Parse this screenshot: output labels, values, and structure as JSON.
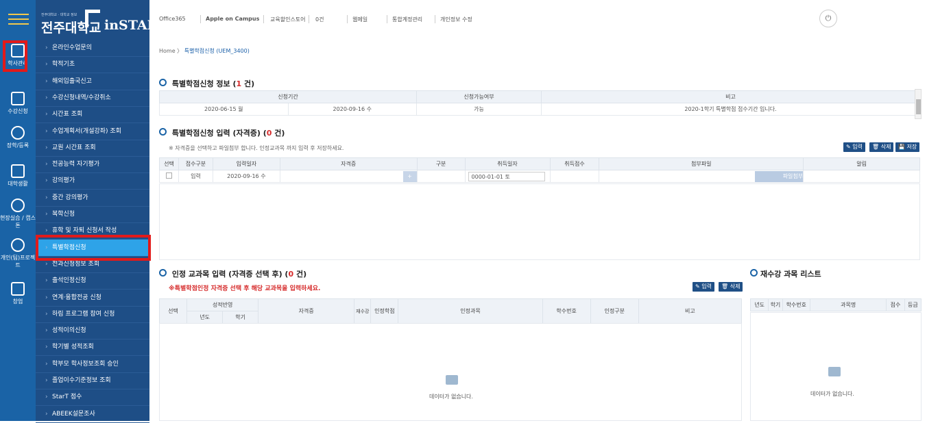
{
  "logo": {
    "tiny": "전주대학교 · 대학교 정보",
    "school": "전주대학교",
    "brand": "inSTAR"
  },
  "rail": [
    {
      "label": "학사관리"
    },
    {
      "label": "수강신청"
    },
    {
      "label": "장학/등록"
    },
    {
      "label": "대학생활"
    },
    {
      "label": "현장실습 / 캡스톤"
    },
    {
      "label": "개인(팀)프로젝트"
    },
    {
      "label": "창업"
    }
  ],
  "nav": [
    "온라인수업문의",
    "학적기초",
    "해외입출국신고",
    "수강신청내역/수강취소",
    "시간표 조회",
    "수업계획서(개설강좌) 조회",
    "교원 시간표 조회",
    "전공능력 자기평가",
    "강의평가",
    "중간 강의평가",
    "복학신청",
    "휴학 및 자퇴 신청서 작성",
    "특별학점신청",
    "전과신청정보 조회",
    "출석인정신청",
    "연계·융합전공 신청",
    "하림 프로그램 참여 신청",
    "성적이의신청",
    "학기별 성적조회",
    "학부모 학사정보조회 승인",
    "졸업이수기준정보 조회",
    "StarT 점수",
    "ABEEK설문조사"
  ],
  "topbar": [
    "Office365",
    "Apple on Campus",
    "교육할인스토어",
    "0건",
    "웹메일",
    "통합계정관리",
    "개인정보 수정"
  ],
  "power_icon": "power-icon",
  "breadcrumb": {
    "home": "Home",
    "sep": "〉",
    "page": "특별학점신청 (UEM_3400)"
  },
  "info": {
    "title": "특별학점신청 정보 (",
    "count": "1",
    "suffix": " 건)",
    "headers": [
      "신청기간",
      "신청가능여부",
      "비고"
    ],
    "row": [
      "2020-06-15 월",
      "2020-09-16 수",
      "가능",
      "2020-1학기 특별학점 접수기간 입니다."
    ]
  },
  "input": {
    "title": "특별학점신청 입력 (자격증) (",
    "count": "0",
    "suffix": " 건)",
    "note": "※ 자격증을 선택하고 파일첨부 합니다. 인정교과목 까지 입력 후 저장하세요.",
    "buttons": [
      "입력",
      "삭제",
      "저장"
    ],
    "headers": [
      "선택",
      "접수구분",
      "입력일자",
      "자격증",
      "구분",
      "취득일자",
      "취득점수",
      "첨부파일",
      "알림"
    ],
    "row": {
      "type": "입력",
      "date": "2020-09-16 수",
      "plus": "+",
      "acq_date": "0000-01-01 토",
      "attach": "파일첨부"
    }
  },
  "course": {
    "title": "인정 교과목 입력 (자격증 선택 후) (",
    "count": "0",
    "suffix": " 건)",
    "note": "※특별학점인정 자격증 선택 후 해당 교과목을 입력하세요.",
    "buttons": [
      "입력",
      "삭제"
    ],
    "headers": [
      "선택",
      "성적반영",
      "년도",
      "학기",
      "자격증",
      "재수강",
      "인정학점",
      "인정과목",
      "학수번호",
      "인정구분",
      "비고"
    ],
    "empty": "데이터가 없습니다."
  },
  "retake": {
    "title": "재수강 과목 리스트",
    "headers": [
      "년도",
      "학기",
      "학수번호",
      "과목명",
      "점수",
      "등급"
    ],
    "empty": "데이터가 없습니다."
  }
}
